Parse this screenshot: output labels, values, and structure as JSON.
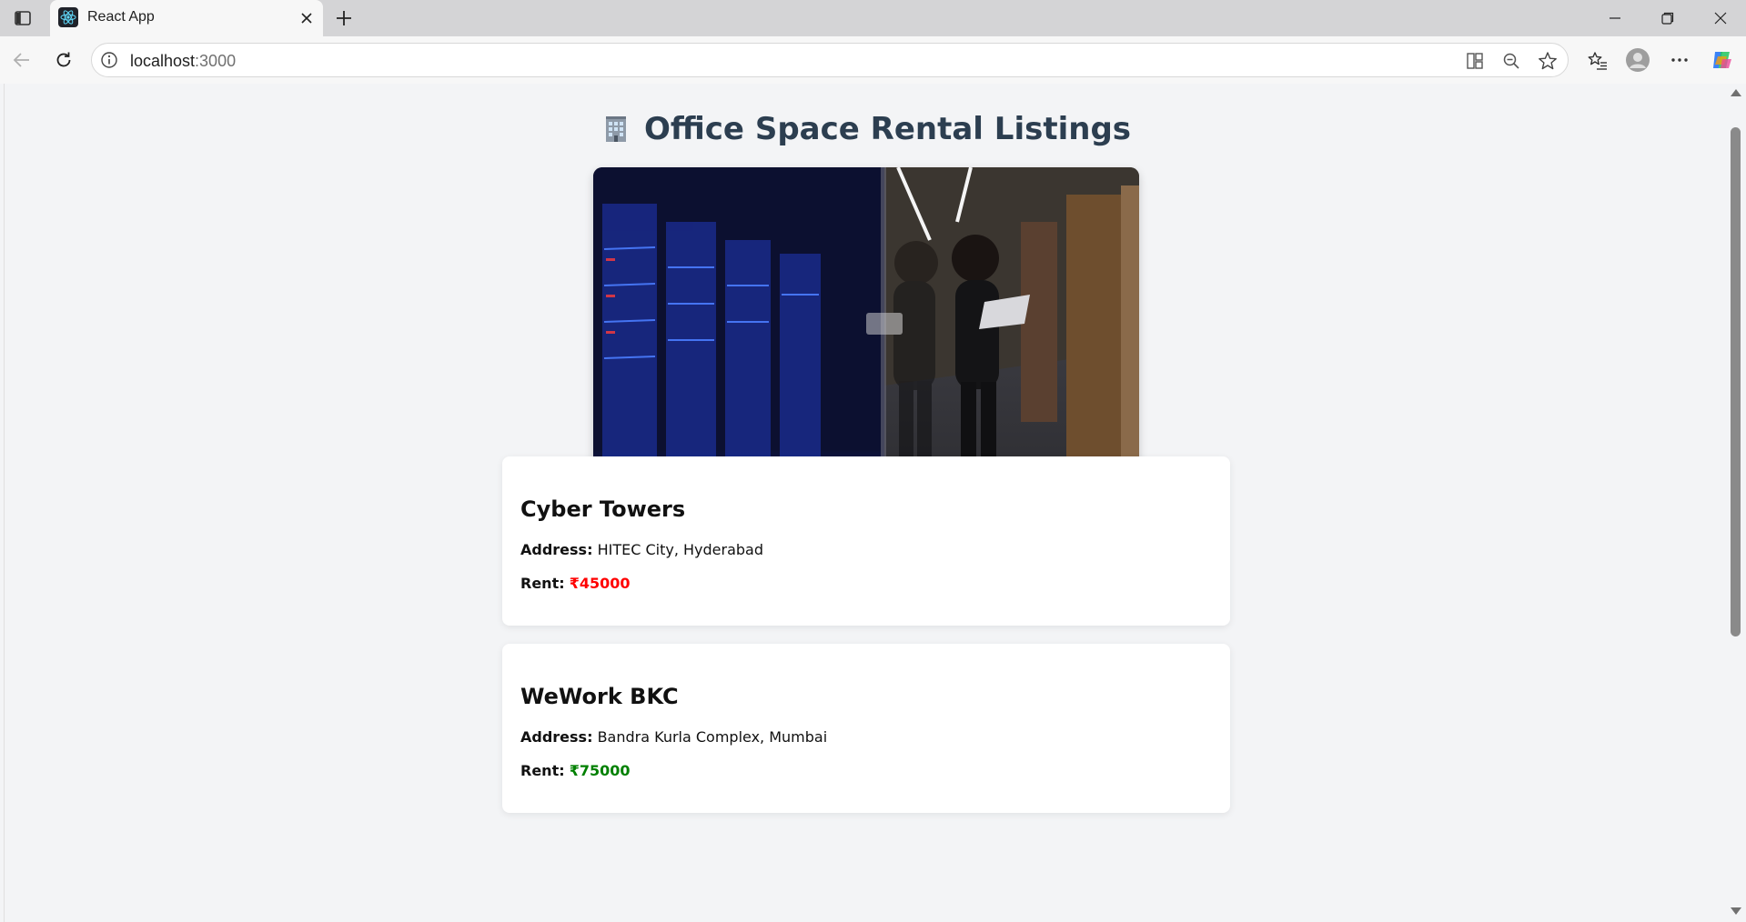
{
  "browser": {
    "tab_title": "React App",
    "url_host": "localhost",
    "url_port": ":3000"
  },
  "page": {
    "title": "Office Space Rental Listings",
    "title_icon": "office-building-icon",
    "hero_alt": "office-hero-image"
  },
  "listings": [
    {
      "name": "Cyber Towers",
      "address_label": "Address:",
      "address": "HITEC City, Hyderabad",
      "rent_label": "Rent:",
      "rent": "₹45000",
      "rent_color": "#ff0000"
    },
    {
      "name": "WeWork BKC",
      "address_label": "Address:",
      "address": "Bandra Kurla Complex, Mumbai",
      "rent_label": "Rent:",
      "rent": "₹75000",
      "rent_color": "#008000"
    }
  ],
  "colors": {
    "title": "#2c3e50",
    "rent_high": "#ff0000",
    "rent_low": "#008000"
  }
}
